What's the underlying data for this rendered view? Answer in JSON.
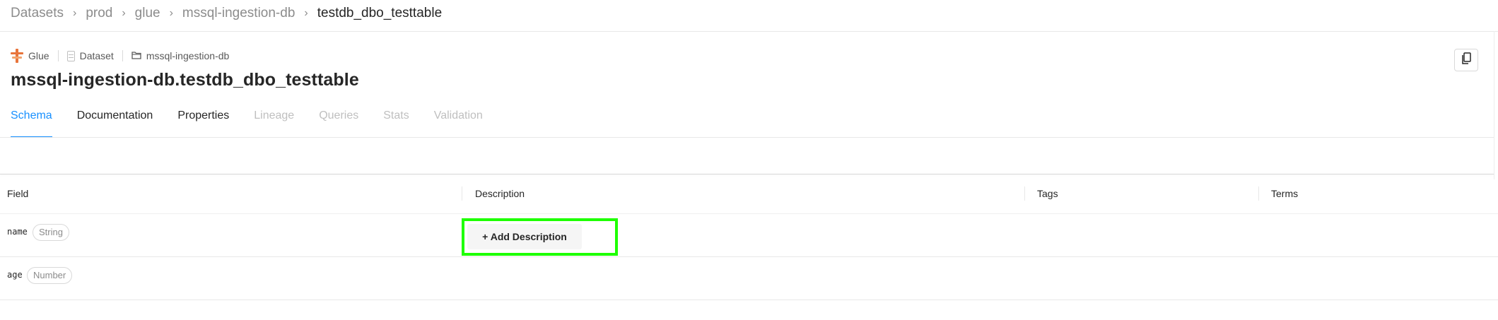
{
  "breadcrumb": {
    "items": [
      "Datasets",
      "prod",
      "glue",
      "mssql-ingestion-db"
    ],
    "current": "testdb_dbo_testtable",
    "separator": "›"
  },
  "entity": {
    "platform": "Glue",
    "type": "Dataset",
    "container": "mssql-ingestion-db",
    "title": "mssql-ingestion-db.testdb_dbo_testtable"
  },
  "tabs": [
    {
      "label": "Schema",
      "state": "active"
    },
    {
      "label": "Documentation",
      "state": "enabled"
    },
    {
      "label": "Properties",
      "state": "enabled"
    },
    {
      "label": "Lineage",
      "state": "disabled"
    },
    {
      "label": "Queries",
      "state": "disabled"
    },
    {
      "label": "Stats",
      "state": "disabled"
    },
    {
      "label": "Validation",
      "state": "disabled"
    }
  ],
  "schema_table": {
    "columns": [
      "Field",
      "Description",
      "Tags",
      "Terms"
    ],
    "rows": [
      {
        "field": "name",
        "type": "String",
        "description_action": "+ Add Description"
      },
      {
        "field": "age",
        "type": "Number"
      }
    ]
  },
  "colors": {
    "accent": "#1890ff",
    "highlight": "#1eff00",
    "glue_orange": "#e8743b"
  },
  "icons": {
    "platform": "glue-logo-icon",
    "dataset": "dataset-icon",
    "container": "folder-icon",
    "copy": "copy-icon"
  }
}
